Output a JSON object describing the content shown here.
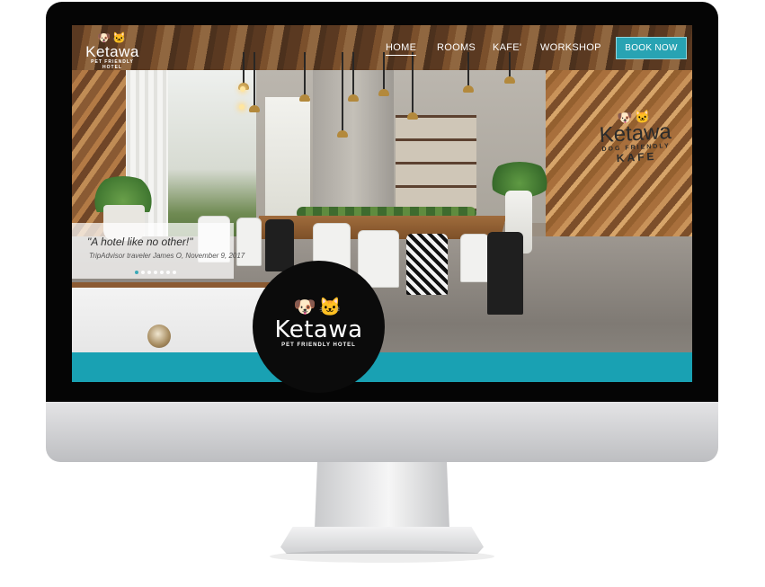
{
  "nav": {
    "logo": {
      "brand": "Ketawa",
      "tagline": "PET FRIENDLY HOTEL",
      "icon": "dog-cat-icon"
    },
    "links": [
      {
        "label": "HOME",
        "active": true
      },
      {
        "label": "ROOMS",
        "active": false
      },
      {
        "label": "KAFE'",
        "active": false
      },
      {
        "label": "WORKSHOP",
        "active": false
      }
    ],
    "cta": "BOOK NOW"
  },
  "wall_sign": {
    "brand": "Ketawa",
    "subtitle": "DOG FRIENDLY",
    "kafe": "KAFE"
  },
  "testimonial": {
    "quote": "\"A hotel like no other!\"",
    "author": "TripAdvisor traveler James O, November 9, 2017",
    "slide_count": 7,
    "active_slide": 1
  },
  "badge": {
    "brand": "Ketawa",
    "tagline": "PET FRIENDLY HOTEL"
  },
  "colors": {
    "accent": "#19a1b3",
    "bezel": "#050505",
    "badge": "#0b0b0b"
  }
}
